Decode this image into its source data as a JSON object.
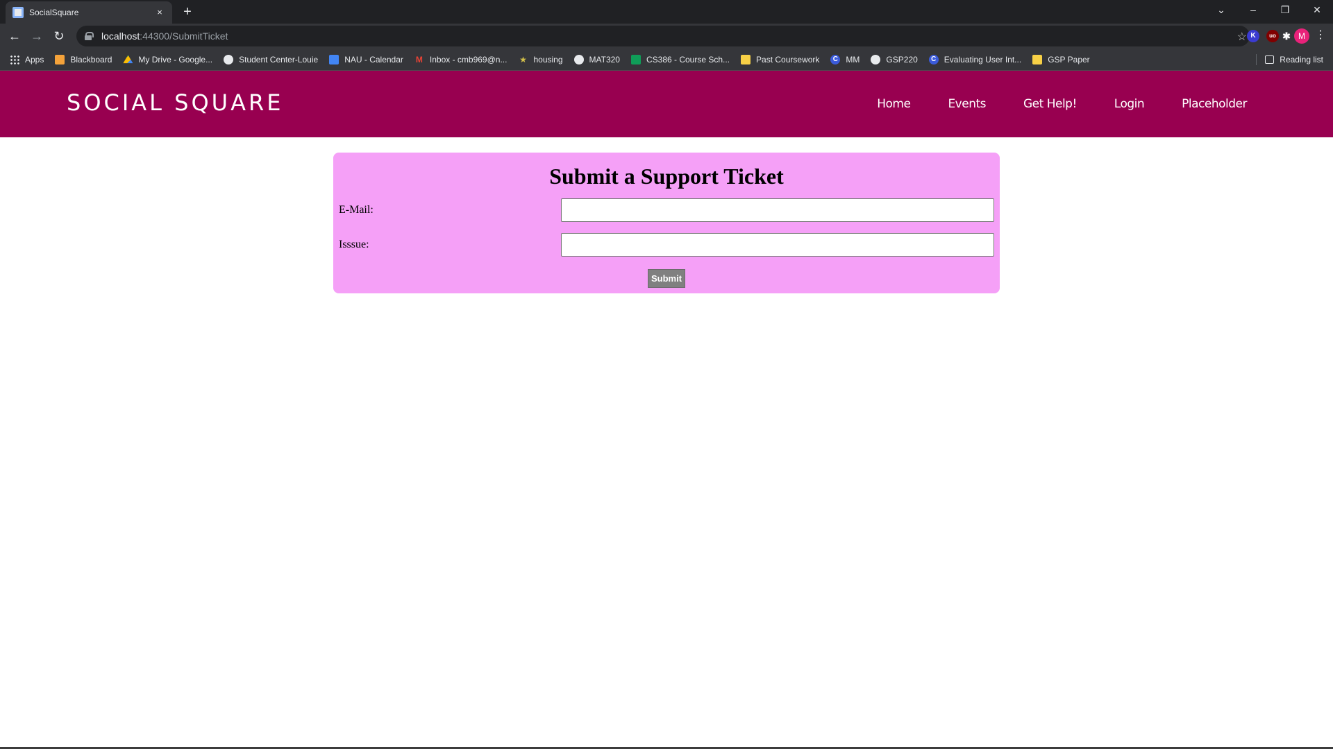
{
  "browser": {
    "tab": {
      "title": "SocialSquare",
      "close_glyph": "×"
    },
    "new_tab_glyph": "+",
    "window_controls": {
      "dropdown": "⌄",
      "minimize": "–",
      "restore": "❐",
      "close": "✕"
    },
    "nav": {
      "back": "←",
      "forward": "→",
      "reload": "↻"
    },
    "url": {
      "host": "localhost",
      "rest": ":44300/SubmitTicket"
    },
    "bookmark_star": "☆",
    "extensions": [
      {
        "icon": "kami-icon",
        "label": "K",
        "color": "#3b3bd1"
      },
      {
        "icon": "ublock-icon",
        "label": "uo",
        "color": "#800000"
      },
      {
        "icon": "puzzle-icon",
        "label": "✱",
        "color": "#35363a"
      }
    ],
    "profile_initial": "M",
    "menu_glyph": "⋮",
    "bookmarks": [
      {
        "label": "Apps",
        "icon": "apps-grid-icon"
      },
      {
        "label": "Blackboard",
        "icon": "blackboard-icon",
        "color": "#f4a23a"
      },
      {
        "label": "My Drive - Google...",
        "icon": "google-drive-icon",
        "color": "#34a853"
      },
      {
        "label": "Student Center-Louie",
        "icon": "globe-icon"
      },
      {
        "label": "NAU - Calendar",
        "icon": "calendar-icon",
        "color": "#4285f4"
      },
      {
        "label": "Inbox - cmb969@n...",
        "icon": "gmail-icon",
        "color": "#ea4335"
      },
      {
        "label": "housing",
        "icon": "housing-icon",
        "color": "#d4c14a"
      },
      {
        "label": "MAT320",
        "icon": "globe-icon"
      },
      {
        "label": "CS386 - Course Sch...",
        "icon": "sheets-icon",
        "color": "#0f9d58"
      },
      {
        "label": "Past Coursework",
        "icon": "folder-icon",
        "color": "#f7d046"
      },
      {
        "label": "MM",
        "icon": "c-icon"
      },
      {
        "label": "GSP220",
        "icon": "globe-icon"
      },
      {
        "label": "Evaluating User Int...",
        "icon": "c-icon"
      },
      {
        "label": "GSP Paper",
        "icon": "folder-icon",
        "color": "#f7d046"
      }
    ],
    "reading_list": "Reading list"
  },
  "site": {
    "brand": "SOCIAL SQUARE",
    "nav": [
      "Home",
      "Events",
      "Get Help!",
      "Login",
      "Placeholder"
    ],
    "header_color": "#980050"
  },
  "form": {
    "title": "Submit a Support Ticket",
    "email_label": "E-Mail:",
    "email_value": "",
    "issue_label": "Isssue:",
    "issue_value": "",
    "submit_label": "Submit",
    "card_color": "#f5a0f7"
  }
}
